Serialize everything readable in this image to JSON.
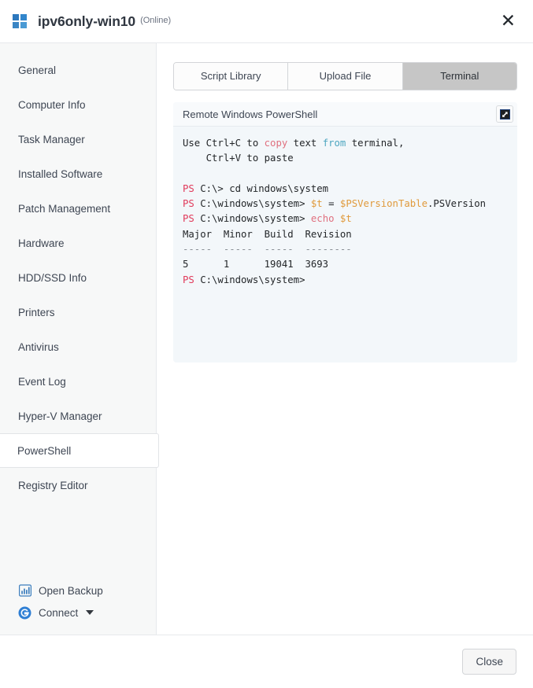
{
  "header": {
    "logo_icon": "windows-logo-icon",
    "host_name": "ipv6only-win10",
    "status": "(Online)",
    "close_glyph": "✕"
  },
  "sidebar": {
    "items": [
      {
        "label": "General",
        "active": false
      },
      {
        "label": "Computer Info",
        "active": false
      },
      {
        "label": "Task Manager",
        "active": false
      },
      {
        "label": "Installed Software",
        "active": false
      },
      {
        "label": "Patch Management",
        "active": false
      },
      {
        "label": "Hardware",
        "active": false
      },
      {
        "label": "HDD/SSD Info",
        "active": false
      },
      {
        "label": "Printers",
        "active": false
      },
      {
        "label": "Antivirus",
        "active": false
      },
      {
        "label": "Event Log",
        "active": false
      },
      {
        "label": "Hyper-V Manager",
        "active": false
      },
      {
        "label": "PowerShell",
        "active": true
      },
      {
        "label": "Registry Editor",
        "active": false
      }
    ],
    "bottom": {
      "open_backup": {
        "label": "Open Backup",
        "icon": "bar-chart-icon"
      },
      "connect": {
        "label": "Connect",
        "icon": "connect-globe-icon",
        "caret": "chevron-down-icon"
      }
    }
  },
  "main": {
    "tabs": [
      {
        "label": "Script Library",
        "active": false
      },
      {
        "label": "Upload File",
        "active": false
      },
      {
        "label": "Terminal",
        "active": true
      }
    ],
    "terminal": {
      "title": "Remote Windows PowerShell",
      "popout_icon": "expand-popout-icon",
      "lines": [
        [
          {
            "t": "Use Ctrl+C to ",
            "c": "plain"
          },
          {
            "t": "copy",
            "c": "red"
          },
          {
            "t": " text ",
            "c": "plain"
          },
          {
            "t": "from",
            "c": "cyan"
          },
          {
            "t": " terminal,",
            "c": "plain"
          }
        ],
        [
          {
            "t": "    Ctrl+V to paste",
            "c": "plain"
          }
        ],
        [
          {
            "t": "",
            "c": "plain"
          }
        ],
        [
          {
            "t": "PS",
            "c": "ps"
          },
          {
            "t": " C:\\> cd windows\\system",
            "c": "plain"
          }
        ],
        [
          {
            "t": "PS",
            "c": "ps"
          },
          {
            "t": " C:\\windows\\system> ",
            "c": "plain"
          },
          {
            "t": "$t",
            "c": "var"
          },
          {
            "t": " = ",
            "c": "plain"
          },
          {
            "t": "$PSVersionTable",
            "c": "var"
          },
          {
            "t": ".PSVersion",
            "c": "plain"
          }
        ],
        [
          {
            "t": "PS",
            "c": "ps"
          },
          {
            "t": " C:\\windows\\system> ",
            "c": "plain"
          },
          {
            "t": "echo",
            "c": "red"
          },
          {
            "t": " ",
            "c": "plain"
          },
          {
            "t": "$t",
            "c": "var"
          }
        ],
        [
          {
            "t": "Major  Minor  Build  Revision",
            "c": "plain"
          }
        ],
        [
          {
            "t": "-----  -----  -----  --------",
            "c": "dash"
          }
        ],
        [
          {
            "t": "5      1      19041  3693",
            "c": "plain"
          }
        ],
        [
          {
            "t": "PS",
            "c": "ps"
          },
          {
            "t": " C:\\windows\\system>",
            "c": "plain"
          }
        ]
      ]
    }
  },
  "footer": {
    "close_label": "Close"
  },
  "colors": {
    "accent_blue": "#2c78bd",
    "prompt_red": "#e0395a",
    "keyword_red": "#e0707f",
    "keyword_cyan": "#4da6c0",
    "variable_orange": "#e09a3c",
    "terminal_bg": "#f3f7fa",
    "sidebar_bg": "#f7f8f8",
    "active_tab_bg": "#c6c6c6"
  }
}
